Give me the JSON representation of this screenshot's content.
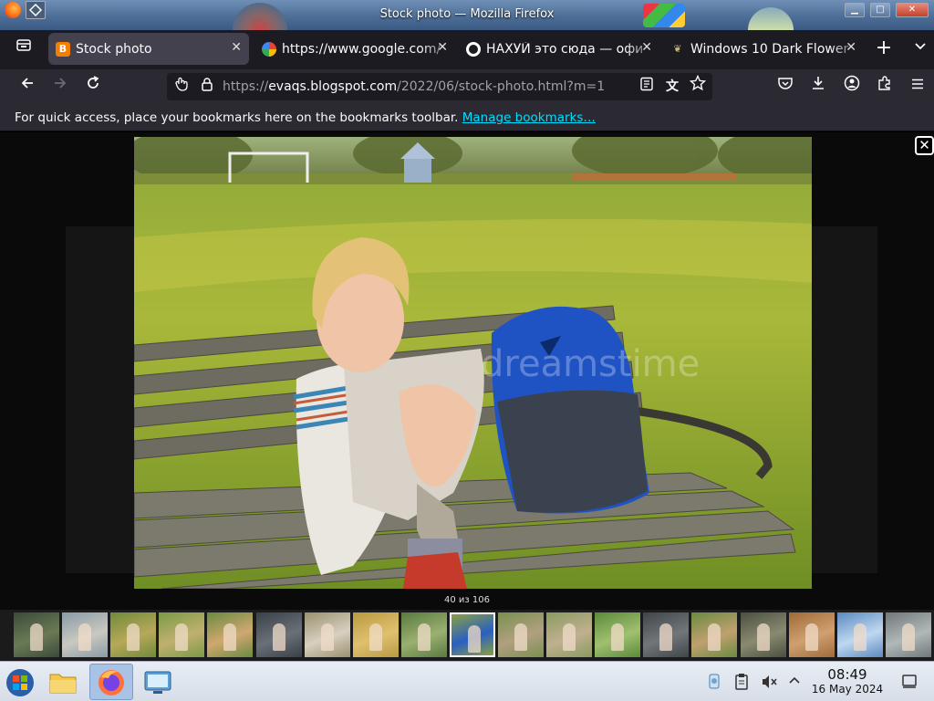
{
  "window": {
    "title": "Stock photo — Mozilla Firefox"
  },
  "tabs": [
    {
      "label": "Stock photo",
      "favicon": "blogger-icon",
      "active": true
    },
    {
      "label": "https://www.google.com/",
      "favicon": "google-icon",
      "active": false
    },
    {
      "label": "НАХУЙ это сюда — офи",
      "favicon": "site-icon",
      "active": false
    },
    {
      "label": "Windows 10 Dark Flower",
      "favicon": "flower-icon",
      "active": false
    }
  ],
  "navbar": {
    "url_prefix": "https://",
    "url_host": "evaqs.blogspot.com",
    "url_path": "/2022/06/stock-photo.html?m=1"
  },
  "bookmarks_bar": {
    "message": "For quick access, place your bookmarks here on the bookmarks toolbar.",
    "link": "Manage bookmarks…"
  },
  "lightbox": {
    "counter": "40 из 106",
    "close_label": "✕",
    "watermark": "dreamstime",
    "selected_thumb": 9,
    "thumb_count": 19
  },
  "taskbar": {
    "clock_time": "08:49",
    "clock_date": "16 May 2024"
  },
  "colors": {
    "accent_link": "#00ddff",
    "tab_active": "#42414d",
    "toolbar": "#2b2a33"
  }
}
